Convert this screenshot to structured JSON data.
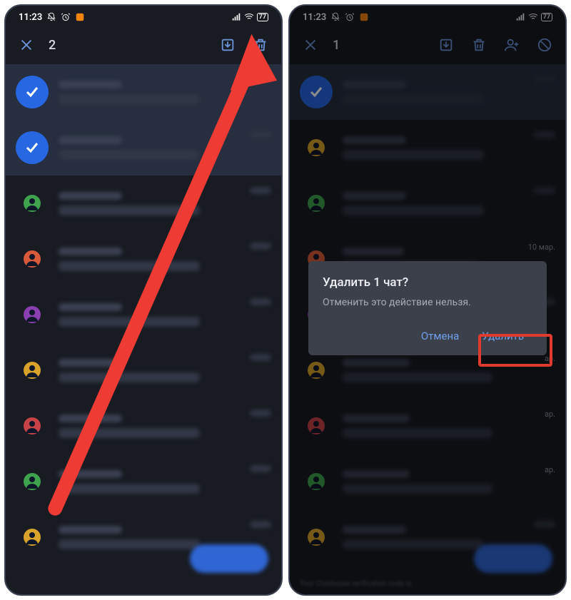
{
  "statusbar": {
    "time": "11:23",
    "battery": "77"
  },
  "screen1": {
    "selected_count": "2",
    "chats": [
      {
        "selected": true,
        "color": "#2767e2"
      },
      {
        "selected": true,
        "color": "#2767e2"
      },
      {
        "selected": false,
        "color": "#3fa24d"
      },
      {
        "selected": false,
        "color": "#d85a3a"
      },
      {
        "selected": false,
        "color": "#8a3fb0"
      },
      {
        "selected": false,
        "color": "#d9a22b"
      },
      {
        "selected": false,
        "color": "#c84347"
      },
      {
        "selected": false,
        "color": "#3fa24d"
      },
      {
        "selected": false,
        "color": "#d9a22b"
      }
    ]
  },
  "screen2": {
    "selected_count": "1",
    "dialog": {
      "title": "Удалить 1 чат?",
      "message": "Отменить это действие нельзя.",
      "cancel": "Отмена",
      "confirm": "Удалить"
    },
    "chats": [
      {
        "selected": true,
        "color": "#2767e2",
        "ts": ""
      },
      {
        "selected": false,
        "color": "#d9a22b",
        "ts": ""
      },
      {
        "selected": false,
        "color": "#3fa24d",
        "ts": ""
      },
      {
        "selected": false,
        "color": "#d85a3a",
        "ts": "10 мар."
      },
      {
        "selected": false,
        "color": "#8a3fb0",
        "ts": ""
      },
      {
        "selected": false,
        "color": "#d9a22b",
        "ts": "ар."
      },
      {
        "selected": false,
        "color": "#c84347",
        "ts": "ар."
      },
      {
        "selected": false,
        "color": "#3fa24d",
        "ts": "ар."
      },
      {
        "selected": false,
        "color": "#d9a22b",
        "ts": ""
      }
    ],
    "footer": "Your Clubhouse verification code is"
  }
}
